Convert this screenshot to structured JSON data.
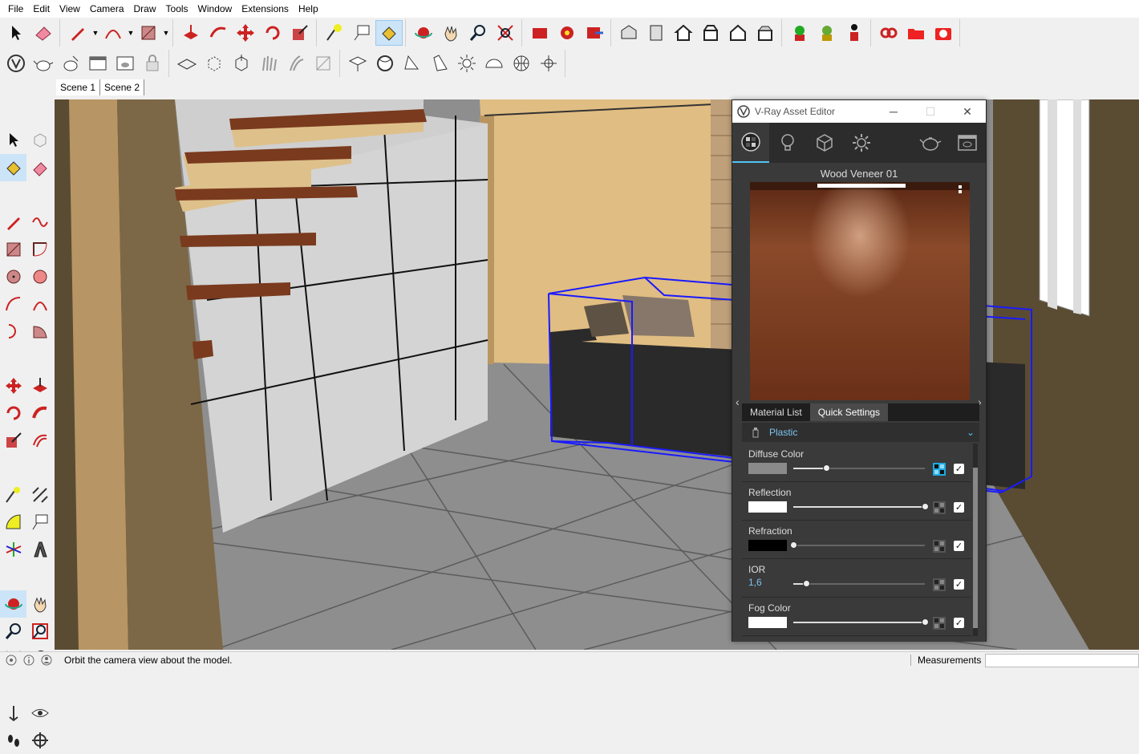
{
  "menu": [
    "File",
    "Edit",
    "View",
    "Camera",
    "Draw",
    "Tools",
    "Window",
    "Extensions",
    "Help"
  ],
  "scenes": [
    "Scene 1",
    "Scene 2"
  ],
  "status": {
    "hint": "Orbit the camera view about the model.",
    "measurements_label": "Measurements",
    "measurements_value": ""
  },
  "vray": {
    "title": "V-Ray Asset Editor",
    "material_name": "Wood Veneer 01",
    "subtabs": [
      "Material List",
      "Quick Settings"
    ],
    "type": "Plastic",
    "props": [
      {
        "label": "Diffuse Color",
        "swatch": "#8a8a8a",
        "value": "",
        "slider": 0.25,
        "textured": true
      },
      {
        "label": "Reflection",
        "swatch": "#ffffff",
        "value": "",
        "slider": 1.0,
        "textured": false
      },
      {
        "label": "Refraction",
        "swatch": "#000000",
        "value": "",
        "slider": 0.0,
        "textured": false
      },
      {
        "label": "IOR",
        "swatch": "",
        "value": "1,6",
        "slider": 0.1,
        "textured": false
      },
      {
        "label": "Fog Color",
        "swatch": "#ffffff",
        "value": "",
        "slider": 1.0,
        "textured": false
      }
    ]
  },
  "colors": {
    "accent": "#4fc3f7",
    "selection_blue": "#1a1aff",
    "wood": "#7a3a1e"
  }
}
